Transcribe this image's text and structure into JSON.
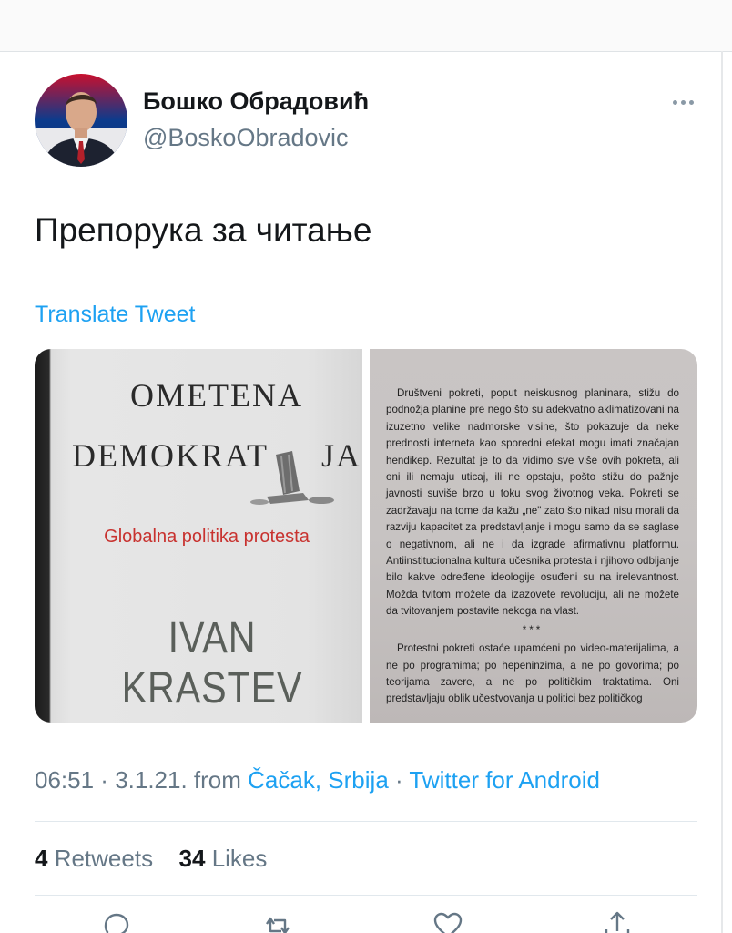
{
  "user": {
    "display_name": "Бошко Обрадовић",
    "handle": "@BoskoObradovic"
  },
  "tweet": {
    "text": "Препорука за читање",
    "translate_label": "Translate Tweet"
  },
  "media": {
    "cover": {
      "title_line1": "OMETENA",
      "title_line2_a": "DEMOKRAT",
      "title_line2_b": "JA",
      "subtitle": "Globalna politika protesta",
      "author": "IVAN KRASTEV"
    },
    "page": {
      "paragraph1": "Društveni pokreti, poput neiskusnog planinara, stižu do podnožja planine pre nego što su adekvatno aklimatizovani na izuzetno velike nadmorske visine, što pokazuje da neke prednosti interneta kao sporedni efekat mogu imati značajan hendikep. Rezultat je to da vidimo sve više ovih pokreta, ali oni ili nemaju uticaj, ili ne opstaju, pošto stižu do pažnje javnosti suviše brzo u toku svog životnog veka. Pokreti se zadržavaju na tome da kažu „ne\" zato što nikad nisu morali da razviju kapacitet za predstavljanje i mogu samo da se saglase o negativnom, ali ne i da izgrade afirmativnu platformu. Antiinstitucionalna kultura učesnika protesta i njihovo odbijanje bilo kakve određene ideologije osuđeni su na irelevantnost. Možda tvitom možete da izazovete revoluciju, ali ne možete da tvitovanjem postavite nekoga na vlast.",
      "separator": "***",
      "paragraph2": "Protestni pokreti ostaće upamćeni po video-materijalima, a ne po programima; po hepeninzima, a ne po govorima; po teorijama zavere, a ne po političkim traktatima. Oni predstavljaju oblik učestvovanja u politici bez političkog"
    }
  },
  "meta": {
    "time": "06:51",
    "sep1": " · ",
    "date": "3.1.21.",
    "from_label": " from ",
    "location": "Čačak, Srbija",
    "sep2": " · ",
    "source": "Twitter for Android"
  },
  "stats": {
    "retweets_count": "4",
    "retweets_label": " Retweets",
    "likes_count": "34",
    "likes_label": " Likes"
  },
  "icons": [
    "more-icon",
    "reply-icon",
    "retweet-icon",
    "like-icon",
    "share-icon"
  ],
  "colors": {
    "link": "#1da1f2",
    "secondary_text": "#657786",
    "primary_text": "#14171a",
    "cover_subtitle": "#c8322f"
  }
}
